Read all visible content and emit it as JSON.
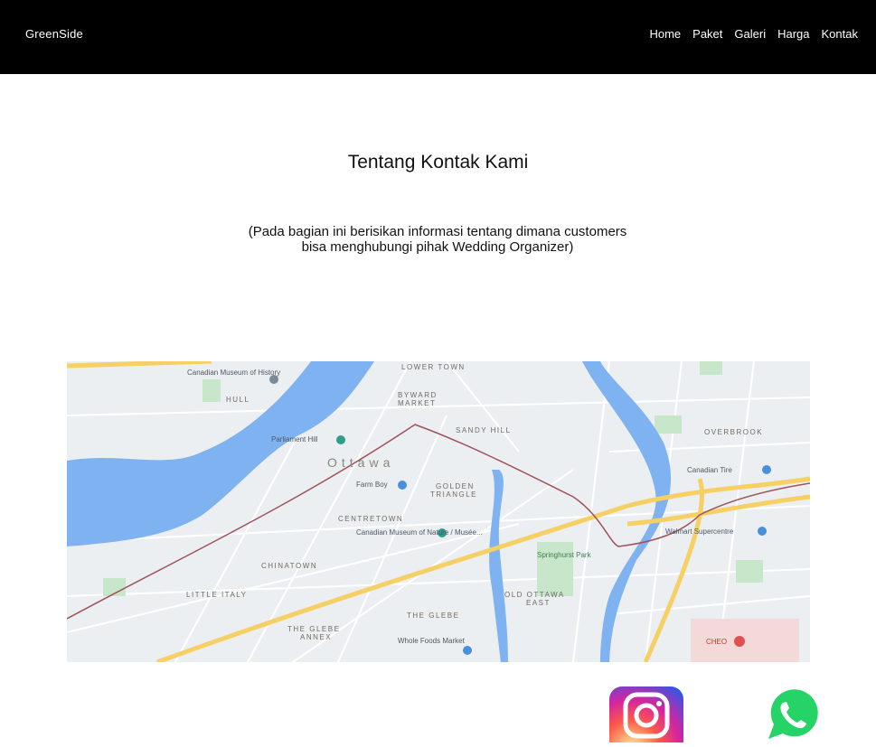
{
  "navbar": {
    "brand": "GreenSide",
    "links": [
      "Home",
      "Paket",
      "Galeri",
      "Harga",
      "Kontak"
    ]
  },
  "content": {
    "title": "Tentang Kontak Kami",
    "description_line1": "(Pada bagian ini  berisikan informasi tentang dimana customers",
    "description_line2": "bisa menghubungi pihak Wedding Organizer)"
  },
  "map": {
    "labels": {
      "ottawa": "Ottawa",
      "lower_town": "LOWER TOWN",
      "byward": "BYWARD",
      "market": "MARKET",
      "sandy_hill": "SANDY HILL",
      "overbrook": "OVERBROOK",
      "hull": "HULL",
      "golden": "GOLDEN",
      "triangle": "TRIANGLE",
      "centretown": "CENTRETOWN",
      "chinatown": "CHINATOWN",
      "little_italy": "LITTLE ITALY",
      "old_ottawa": "OLD OTTAWA",
      "east": "EAST",
      "the_glebe": "THE GLEBE",
      "the_glebe_annex_1": "THE GLEBE",
      "the_glebe_annex_2": "ANNEX",
      "canadian_museum_history": "Canadian Museum of History",
      "parliament_hill": "Parliament Hill",
      "farm_boy": "Farm Boy",
      "canadian_museum_nature": "Canadian Museum of Nature / Musée...",
      "canadian_tire": "Canadian Tire",
      "walmart": "Walmart Supercentre",
      "whole_foods": "Whole Foods Market",
      "springhurst_park": "Springhurst Park",
      "cheo": "CHEO"
    },
    "colors": {
      "water": "#7fb2f0",
      "land": "#eceff1",
      "park": "#c8e6c9",
      "highway": "#f6cf65",
      "rail": "#a0525a"
    }
  },
  "social": {
    "instagram_icon": "instagram-icon",
    "whatsapp_icon": "whatsapp-icon"
  }
}
